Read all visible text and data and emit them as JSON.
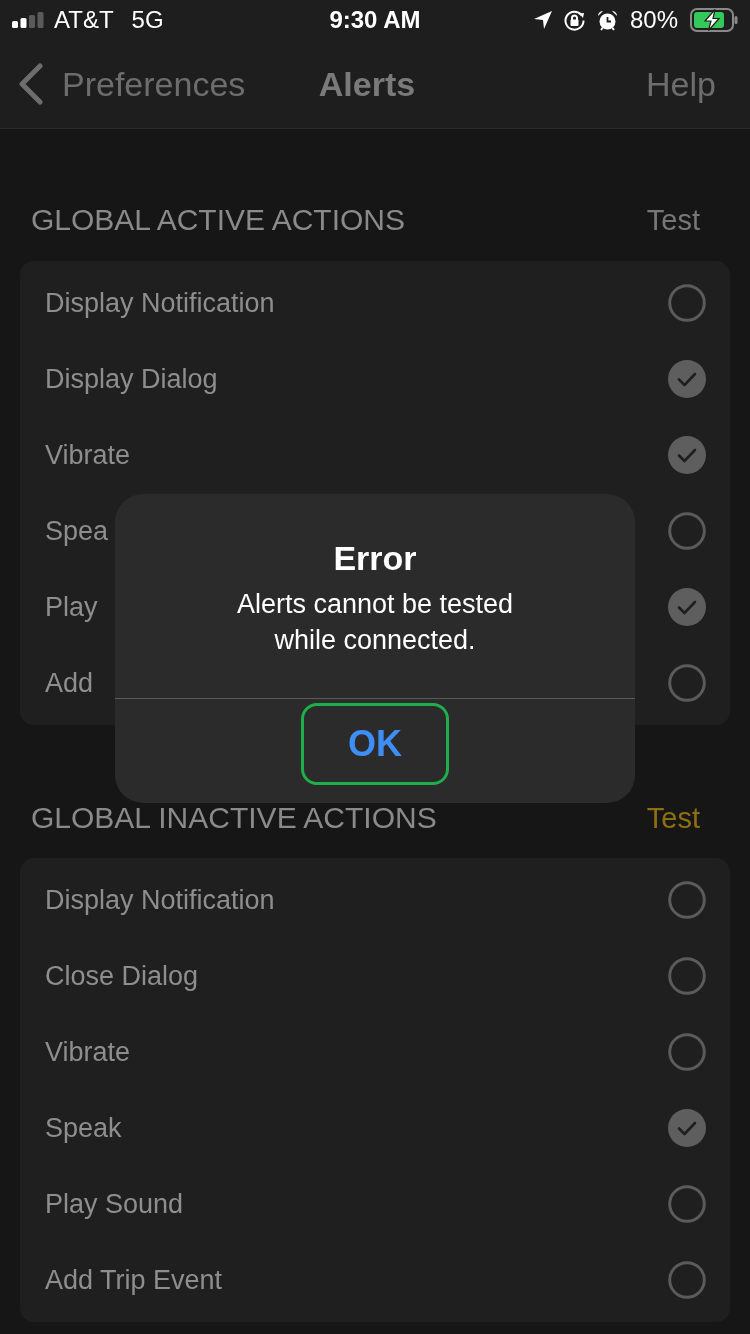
{
  "status_bar": {
    "carrier": "AT&T",
    "network": "5G",
    "time": "9:30 AM",
    "battery": "80%"
  },
  "nav_bar": {
    "back": "Preferences",
    "title": "Alerts",
    "action": "Help"
  },
  "sections": [
    {
      "title": "GLOBAL ACTIVE ACTIONS",
      "test": {
        "label": "Test",
        "disabled": true
      },
      "items": [
        {
          "label": "Display Notification",
          "checked": false
        },
        {
          "label": "Display Dialog",
          "checked": true
        },
        {
          "label": "Vibrate",
          "checked": true
        },
        {
          "label": "Spea",
          "checked": false
        },
        {
          "label": "Play",
          "checked": true
        },
        {
          "label": "Add",
          "checked": false
        }
      ]
    },
    {
      "title": "GLOBAL INACTIVE ACTIONS",
      "test": {
        "label": "Test",
        "disabled": false
      },
      "items": [
        {
          "label": "Display Notification",
          "checked": false
        },
        {
          "label": "Close Dialog",
          "checked": false
        },
        {
          "label": "Vibrate",
          "checked": false
        },
        {
          "label": "Speak",
          "checked": true
        },
        {
          "label": "Play Sound",
          "checked": false
        },
        {
          "label": "Add Trip Event",
          "checked": false
        }
      ]
    }
  ],
  "dialog": {
    "title": "Error",
    "message": "Alerts cannot be tested while connected.",
    "buttons": [
      {
        "label": "OK",
        "focused": true
      }
    ]
  }
}
